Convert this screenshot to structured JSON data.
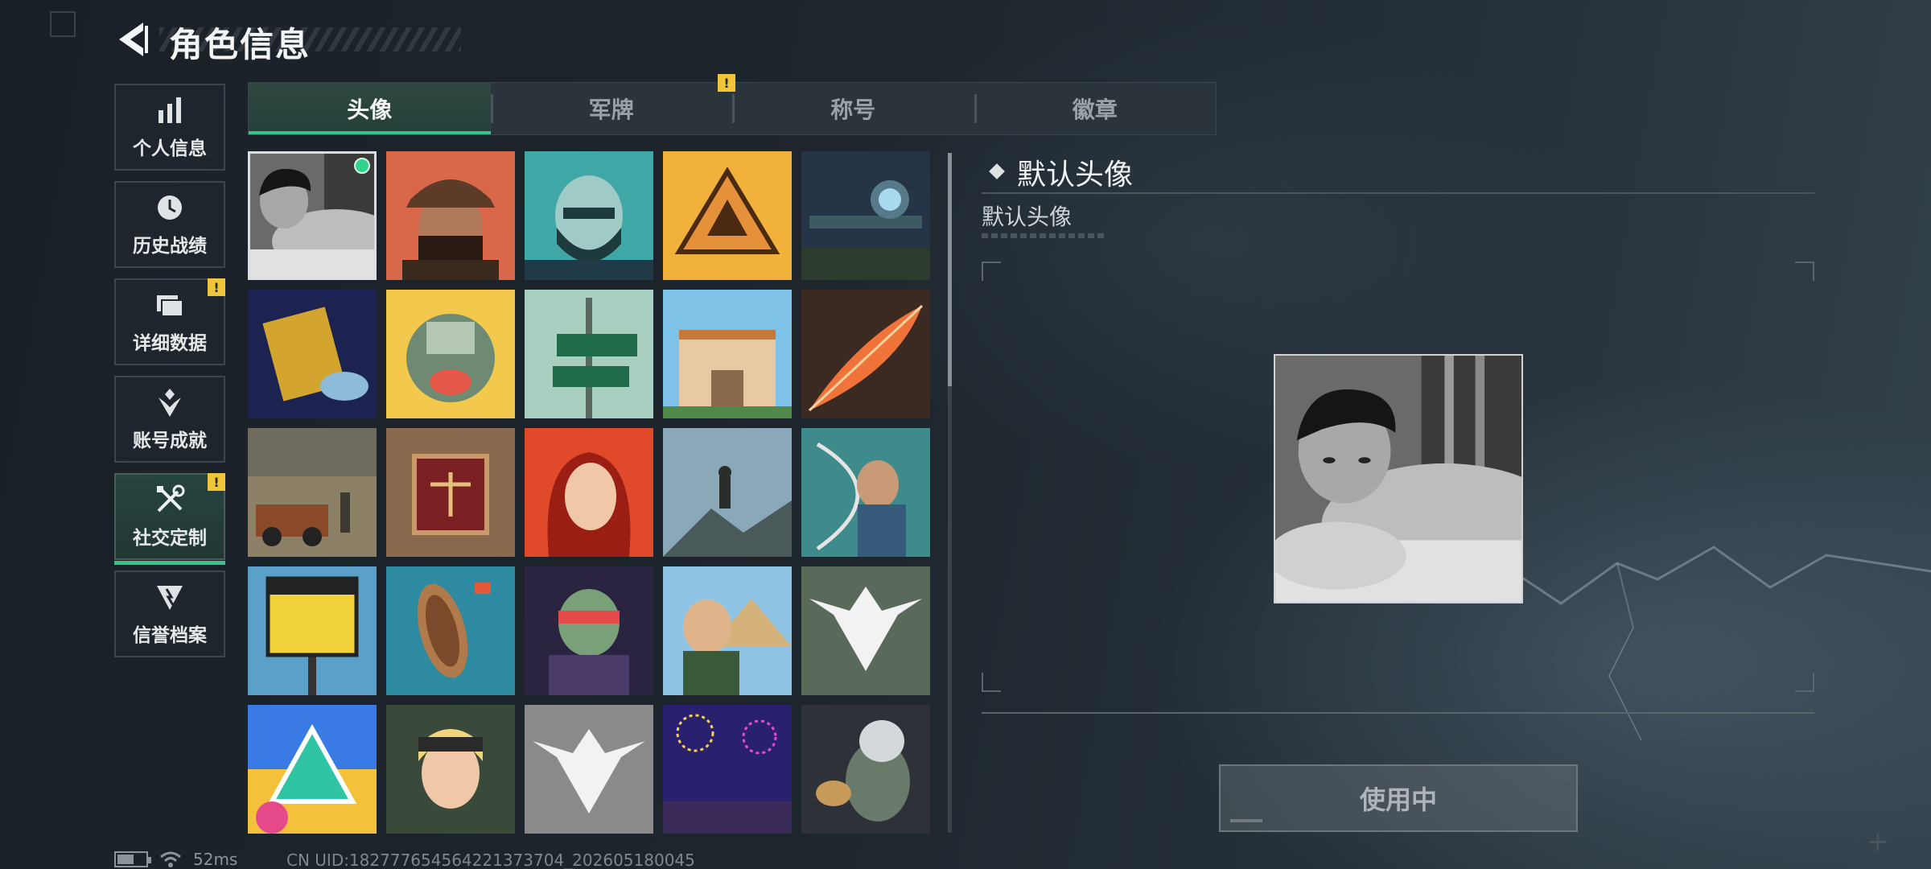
{
  "header": {
    "title": "角色信息"
  },
  "sidebar": {
    "items": [
      {
        "label": "个人信息",
        "icon": "bar-chart-icon",
        "badge": false
      },
      {
        "label": "历史战绩",
        "icon": "history-clock-icon",
        "badge": false
      },
      {
        "label": "详细数据",
        "icon": "folders-icon",
        "badge": true
      },
      {
        "label": "账号成就",
        "icon": "achievement-icon",
        "badge": false
      },
      {
        "label": "社交定制",
        "icon": "tools-icon",
        "badge": true,
        "active": true
      },
      {
        "label": "信誉档案",
        "icon": "reputation-icon",
        "badge": false
      }
    ]
  },
  "tabs": [
    {
      "label": "头像",
      "active": true
    },
    {
      "label": "军牌",
      "badge": true
    },
    {
      "label": "称号"
    },
    {
      "label": "徽章"
    }
  ],
  "badge_symbol": "!",
  "avatars": [
    "bw-portrait",
    "cap-soldier",
    "bearded-man",
    "gold-triangle",
    "sniper-rifle",
    "book-hand",
    "fat-mech",
    "way-out-sign",
    "villa",
    "orange-feather",
    "ruined-car",
    "bronze-scales",
    "red-hair-woman",
    "mountain-man",
    "archer-girl",
    "alligator-sign",
    "rowboat",
    "zombie-warrior",
    "pyramid-selfie",
    "eagle-green",
    "neon-triangle",
    "goggles-girl",
    "eagle-grey",
    "fireworks-2026",
    "cat-soldier"
  ],
  "detail": {
    "title": "默认头像",
    "subtitle": "默认头像"
  },
  "action": {
    "label": "使用中"
  },
  "status": {
    "ping": "52ms",
    "uid": "CN UID:182777654564221373704_202605180045"
  },
  "colors": {
    "accent": "#37c388",
    "warning": "#f0c53c"
  }
}
